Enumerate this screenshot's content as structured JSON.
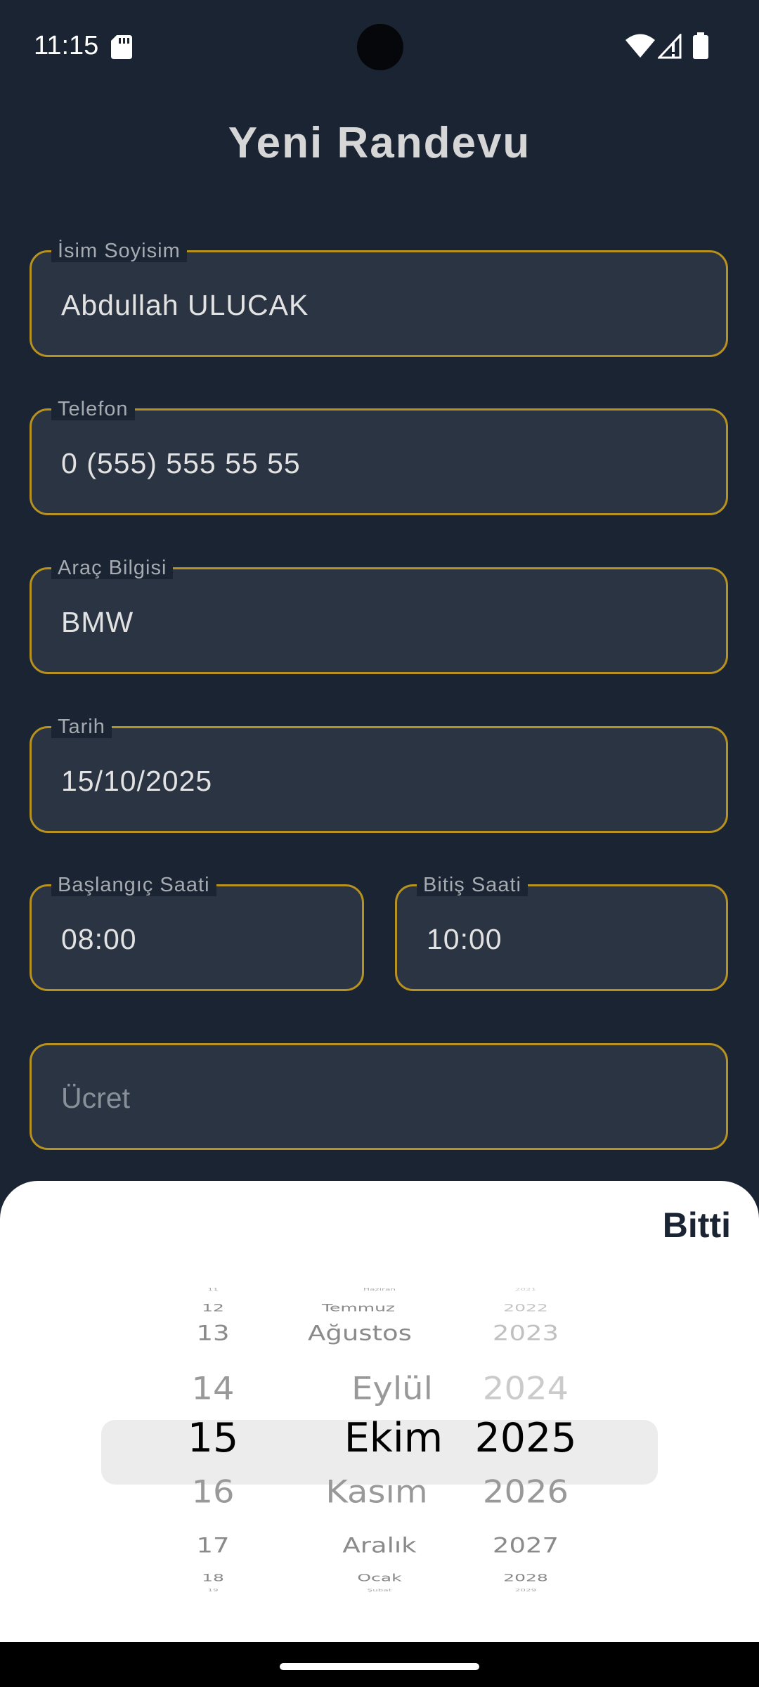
{
  "status_bar": {
    "time": "11:15"
  },
  "title": "Yeni Randevu",
  "form": {
    "name": {
      "label": "İsim Soyisim",
      "value": "Abdullah ULUCAK"
    },
    "phone": {
      "label": "Telefon",
      "value": "0 (555) 555 55 55"
    },
    "vehicle": {
      "label": "Araç Bilgisi",
      "value": "BMW"
    },
    "date": {
      "label": "Tarih",
      "value": "15/10/2025"
    },
    "start_time": {
      "label": "Başlangıç Saati",
      "value": "08:00"
    },
    "end_time": {
      "label": "Bitiş Saati",
      "value": "10:00"
    },
    "fee": {
      "placeholder": "Ücret"
    }
  },
  "sheet": {
    "done_label": "Bitti",
    "picker": {
      "days": [
        "11",
        "12",
        "13",
        "14",
        "15",
        "16",
        "17",
        "18",
        "19"
      ],
      "months": [
        "Haziran",
        "Temmuz",
        "Ağustos",
        "Eylül",
        "Ekim",
        "Kasım",
        "Aralık",
        "Ocak",
        "Şubat"
      ],
      "years": [
        "2021",
        "2022",
        "2023",
        "2024",
        "2025",
        "2026",
        "2027",
        "2028",
        "2029"
      ],
      "selected": {
        "day": "15",
        "month": "Ekim",
        "year": "2025"
      }
    }
  },
  "colors": {
    "background": "#1b2432",
    "field_fill": "#2a3442",
    "field_border": "#b8921f",
    "sheet": "#ffffff"
  }
}
